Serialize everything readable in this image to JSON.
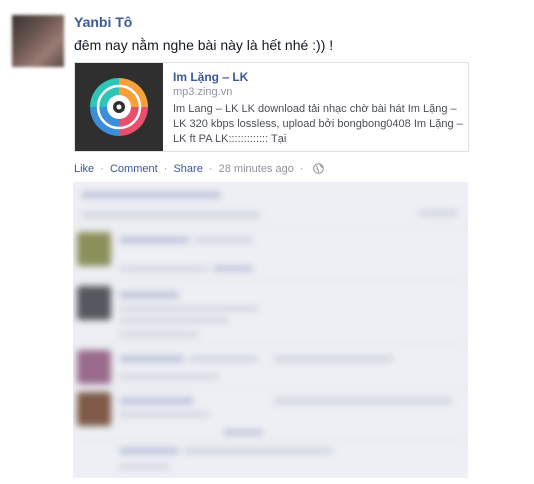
{
  "post": {
    "author": "Yanbi Tô",
    "status_text": "đêm nay nằm nghe bài này là hết nhé :)) !"
  },
  "attachment": {
    "title": "Im Lặng ‒ LK",
    "domain": "mp3.zing.vn",
    "description": "Im Lang ‒ LK LK download tải nhạc chờ bài hát Im Lặng ‒ LK 320 kbps lossless, upload bởi bongbong0408 Im Lặng ‒ LK ft PA LK::::::::::::: Tại",
    "thumb_icon": "music-disc-icon"
  },
  "actions": {
    "like": "Like",
    "comment": "Comment",
    "share": "Share",
    "time": "28 minutes ago",
    "separator": "·",
    "privacy_icon": "globe-icon"
  },
  "colors": {
    "link": "#3b5998",
    "meta": "#90949c",
    "comments_bg": "#edeff4"
  }
}
